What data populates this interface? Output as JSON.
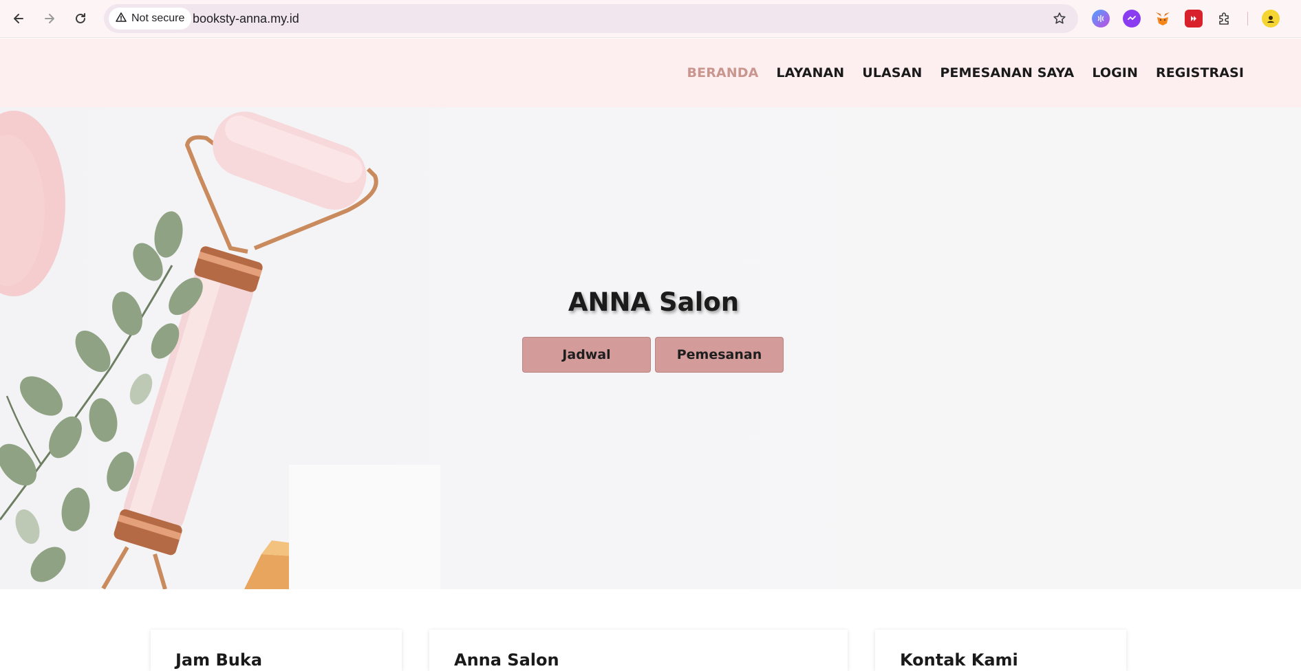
{
  "browser": {
    "security_label": "Not secure",
    "url": "booksty-anna.my.id",
    "icons": [
      "back-arrow-icon",
      "forward-arrow-icon",
      "reload-icon",
      "warning-triangle-icon",
      "star-icon",
      "extension-brain-icon",
      "extension-chat-icon",
      "metamask-fox-icon",
      "extension-play-icon",
      "puzzle-icon",
      "profile-avatar-icon"
    ]
  },
  "site": {
    "nav": [
      {
        "label": "BERANDA",
        "active": true
      },
      {
        "label": "LAYANAN",
        "active": false
      },
      {
        "label": "ULASAN",
        "active": false
      },
      {
        "label": "PEMESANAN SAYA",
        "active": false
      },
      {
        "label": "LOGIN",
        "active": false
      },
      {
        "label": "REGISTRASI",
        "active": false
      }
    ],
    "active_color": "#c9968f",
    "header_bg": "#fdeef0"
  },
  "hero": {
    "title": "ANNA Salon",
    "buttons": [
      {
        "label": "Jadwal"
      },
      {
        "label": "Pemesanan"
      }
    ],
    "button_color": "#d39c9a"
  },
  "cards": [
    {
      "title": "Jam Buka"
    },
    {
      "title": "Anna Salon"
    },
    {
      "title": "Kontak Kami"
    }
  ]
}
